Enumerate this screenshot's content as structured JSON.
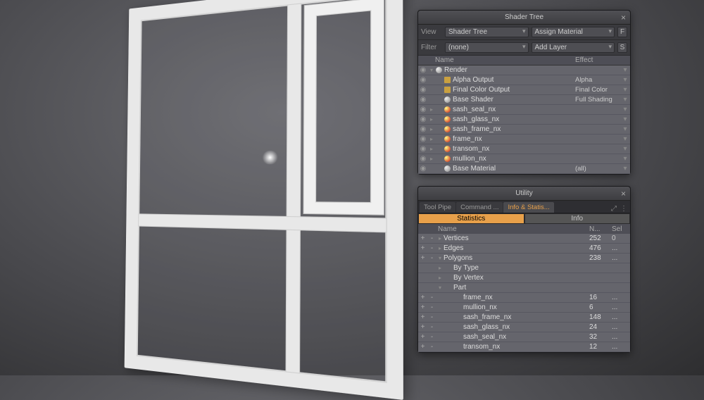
{
  "shader_panel": {
    "title": "Shader Tree",
    "view_label": "View",
    "view_value": "Shader Tree",
    "assign_btn": "Assign Material",
    "assign_key": "F",
    "filter_label": "Filter",
    "filter_value": "(none)",
    "addlayer_btn": "Add Layer",
    "addlayer_key": "S",
    "col_name": "Name",
    "col_effect": "Effect",
    "rows": [
      {
        "eye": "◉",
        "exp": "▾",
        "indent": 0,
        "icon": "grey",
        "name": "Render",
        "effect": ""
      },
      {
        "eye": "◉",
        "exp": "",
        "indent": 1,
        "icon": "cube",
        "name": "Alpha Output",
        "effect": "Alpha"
      },
      {
        "eye": "◉",
        "exp": "",
        "indent": 1,
        "icon": "cube",
        "name": "Final Color Output",
        "effect": "Final Color"
      },
      {
        "eye": "◉",
        "exp": "",
        "indent": 1,
        "icon": "grey",
        "name": "Base Shader",
        "effect": "Full Shading"
      },
      {
        "eye": "◉",
        "exp": "▸",
        "indent": 1,
        "icon": "red",
        "name": "sash_seal_nx",
        "effect": ""
      },
      {
        "eye": "◉",
        "exp": "▸",
        "indent": 1,
        "icon": "red",
        "name": "sash_glass_nx",
        "effect": ""
      },
      {
        "eye": "◉",
        "exp": "▸",
        "indent": 1,
        "icon": "red",
        "name": "sash_frame_nx",
        "effect": ""
      },
      {
        "eye": "◉",
        "exp": "▸",
        "indent": 1,
        "icon": "red",
        "name": "frame_nx",
        "effect": ""
      },
      {
        "eye": "◉",
        "exp": "▸",
        "indent": 1,
        "icon": "red",
        "name": "transom_nx",
        "effect": ""
      },
      {
        "eye": "◉",
        "exp": "▸",
        "indent": 1,
        "icon": "red",
        "name": "mullion_nx",
        "effect": ""
      },
      {
        "eye": "◉",
        "exp": "",
        "indent": 1,
        "icon": "grey",
        "name": "Base Material",
        "effect": "(all)"
      }
    ]
  },
  "utility_panel": {
    "title": "Utility",
    "tabs": [
      "Tool Pipe",
      "Command ...",
      "Info & Statis..."
    ],
    "active_tab": 2,
    "sub_stats": "Statistics",
    "sub_info": "Info",
    "col_name": "Name",
    "col_n": "N...",
    "col_sel": "Sel",
    "rows": [
      {
        "pm1": "+",
        "pm2": "-",
        "exp": "▸",
        "indent": 0,
        "name": "Vertices",
        "num": "252",
        "sel": "0"
      },
      {
        "pm1": "+",
        "pm2": "-",
        "exp": "▸",
        "indent": 0,
        "name": "Edges",
        "num": "476",
        "sel": "..."
      },
      {
        "pm1": "+",
        "pm2": "-",
        "exp": "▾",
        "indent": 0,
        "name": "Polygons",
        "num": "238",
        "sel": "..."
      },
      {
        "pm1": "",
        "pm2": "",
        "exp": "▸",
        "indent": 1,
        "name": "By Type",
        "num": "",
        "sel": ""
      },
      {
        "pm1": "",
        "pm2": "",
        "exp": "▸",
        "indent": 1,
        "name": "By Vertex",
        "num": "",
        "sel": ""
      },
      {
        "pm1": "",
        "pm2": "",
        "exp": "▾",
        "indent": 1,
        "name": "Part",
        "num": "",
        "sel": ""
      },
      {
        "pm1": "+",
        "pm2": "-",
        "exp": "",
        "indent": 2,
        "name": "frame_nx",
        "num": "16",
        "sel": "..."
      },
      {
        "pm1": "+",
        "pm2": "-",
        "exp": "",
        "indent": 2,
        "name": "mullion_nx",
        "num": "6",
        "sel": "..."
      },
      {
        "pm1": "+",
        "pm2": "-",
        "exp": "",
        "indent": 2,
        "name": "sash_frame_nx",
        "num": "148",
        "sel": "..."
      },
      {
        "pm1": "+",
        "pm2": "-",
        "exp": "",
        "indent": 2,
        "name": "sash_glass_nx",
        "num": "24",
        "sel": "..."
      },
      {
        "pm1": "+",
        "pm2": "-",
        "exp": "",
        "indent": 2,
        "name": "sash_seal_nx",
        "num": "32",
        "sel": "..."
      },
      {
        "pm1": "+",
        "pm2": "-",
        "exp": "",
        "indent": 2,
        "name": "transom_nx",
        "num": "12",
        "sel": "..."
      }
    ]
  }
}
